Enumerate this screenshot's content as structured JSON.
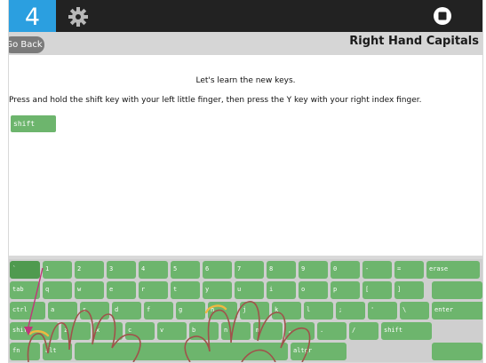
{
  "header": {
    "level": "4",
    "settings_icon": "gear-icon",
    "stop_icon": "stop-icon"
  },
  "subheader": {
    "back_label": "Go Back",
    "lesson_title": "Right Hand Capitals"
  },
  "lesson": {
    "intro": "Let's learn the new keys.",
    "instruction": "Press and hold the shift key with your left little finger, then press the Y key with your right index finger.",
    "current_key": "shift"
  },
  "keyboard": {
    "rows": [
      [
        "`",
        "1",
        "2",
        "3",
        "4",
        "5",
        "6",
        "7",
        "8",
        "9",
        "0",
        "-",
        "=",
        "erase"
      ],
      [
        "tab",
        "q",
        "w",
        "e",
        "r",
        "t",
        "y",
        "u",
        "i",
        "o",
        "p",
        "[",
        "]"
      ],
      [
        "ctrl",
        "a",
        "s",
        "d",
        "f",
        "g",
        "h",
        "j",
        "k",
        "l",
        ";",
        "'",
        "\\",
        "enter"
      ],
      [
        "shift",
        "z",
        "x",
        "c",
        "v",
        "b",
        "n",
        "m",
        ",",
        ".",
        "/",
        "shift"
      ],
      [
        "fn",
        "alt",
        "",
        "altgr"
      ]
    ]
  },
  "colors": {
    "topbar": "#222222",
    "level_badge": "#2b9fe0",
    "key": "#6db56d",
    "hand_outline": "#a0524b",
    "finger_highlight": "#f0b840",
    "indicator": "#c0357a"
  }
}
